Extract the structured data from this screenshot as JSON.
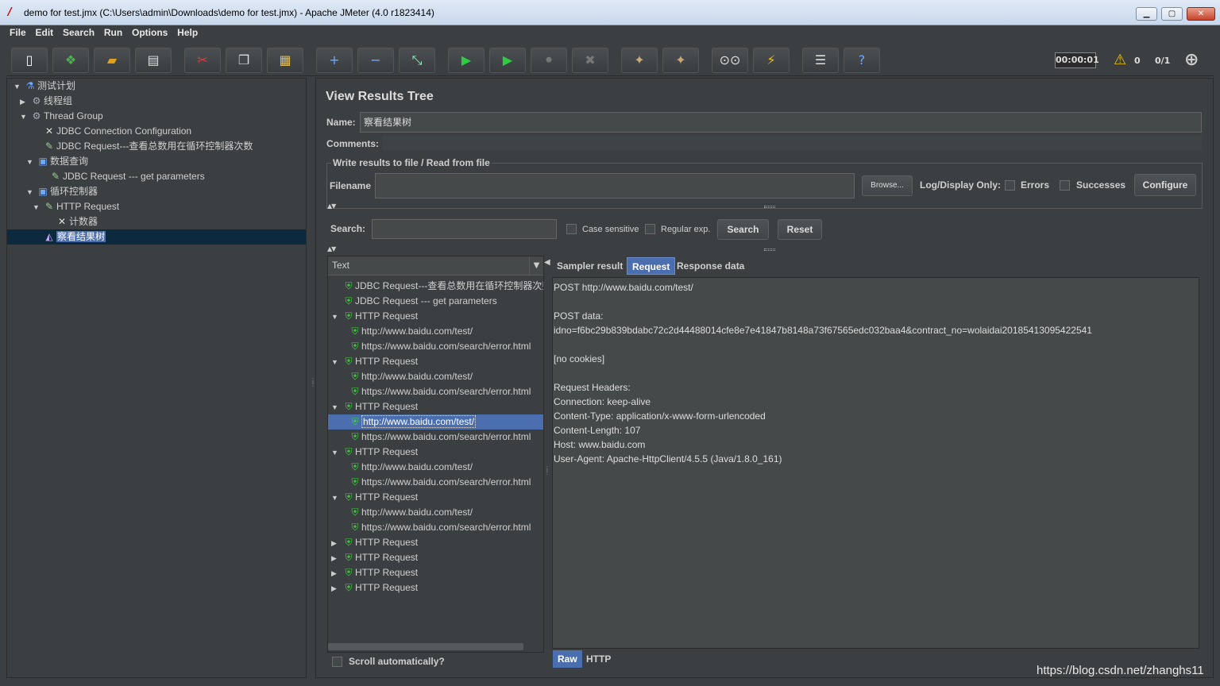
{
  "window": {
    "title": "demo for test.jmx (C:\\Users\\admin\\Downloads\\demo for test.jmx) - Apache JMeter (4.0 r1823414)"
  },
  "menu": [
    "File",
    "Edit",
    "Search",
    "Run",
    "Options",
    "Help"
  ],
  "toolbar": {
    "timer": "00:00:01",
    "warnings": "0",
    "threads": "0/1"
  },
  "tree": [
    {
      "label": "测试计划",
      "icon": "flask-icon",
      "glyph": "⚗",
      "arrow": "▼"
    },
    {
      "label": "线程组",
      "icon": "gear-icon",
      "glyph": "⚙",
      "arrow": "▶"
    },
    {
      "label": "Thread Group",
      "icon": "gear-icon",
      "glyph": "⚙",
      "arrow": "▼"
    },
    {
      "label": "JDBC Connection Configuration",
      "icon": "wrench-icon",
      "glyph": "✕",
      "arrow": ""
    },
    {
      "label": "JDBC Request---查看总数用在循环控制器次数",
      "icon": "pipette-icon",
      "glyph": "✎",
      "arrow": ""
    },
    {
      "label": "数据查询",
      "icon": "controller-icon",
      "glyph": "▣",
      "arrow": "▼"
    },
    {
      "label": "JDBC Request --- get parameters",
      "icon": "pipette-icon",
      "glyph": "✎",
      "arrow": ""
    },
    {
      "label": "循环控制器",
      "icon": "controller-icon",
      "glyph": "▣",
      "arrow": "▼"
    },
    {
      "label": "HTTP Request",
      "icon": "pipette-icon",
      "glyph": "✎",
      "arrow": "▼"
    },
    {
      "label": "计数器",
      "icon": "wrench-icon",
      "glyph": "✕",
      "arrow": ""
    },
    {
      "label": "察看结果树",
      "icon": "chart-icon",
      "glyph": "◭",
      "arrow": ""
    }
  ],
  "panel": {
    "title": "View Results Tree",
    "name_label": "Name:",
    "name_value": "察看结果树",
    "comments_label": "Comments:",
    "fieldset_legend": "Write results to file / Read from file",
    "filename_label": "Filename",
    "browse": "Browse...",
    "log_display": "Log/Display Only:",
    "errors": "Errors",
    "successes": "Successes",
    "configure": "Configure",
    "search_label": "Search:",
    "case_sensitive": "Case sensitive",
    "regular_exp": "Regular exp.",
    "search_btn": "Search",
    "reset_btn": "Reset",
    "list_header": "Text",
    "scroll_auto": "Scroll automatically?",
    "tabs": [
      "Sampler result",
      "Request",
      "Response data"
    ],
    "bottom_tabs": [
      "Raw",
      "HTTP"
    ]
  },
  "results": [
    {
      "label": "JDBC Request---查看总数用在循环控制器次数",
      "arrow": ""
    },
    {
      "label": "JDBC Request --- get parameters",
      "arrow": ""
    },
    {
      "label": "HTTP Request",
      "arrow": "▼"
    },
    {
      "label": "http://www.baidu.com/test/",
      "arrow": "",
      "child": true
    },
    {
      "label": "https://www.baidu.com/search/error.html",
      "arrow": "",
      "child": true
    },
    {
      "label": "HTTP Request",
      "arrow": "▼"
    },
    {
      "label": "http://www.baidu.com/test/",
      "arrow": "",
      "child": true
    },
    {
      "label": "https://www.baidu.com/search/error.html",
      "arrow": "",
      "child": true
    },
    {
      "label": "HTTP Request",
      "arrow": "▼"
    },
    {
      "label": "http://www.baidu.com/test/",
      "arrow": "",
      "child": true,
      "selected": true
    },
    {
      "label": "https://www.baidu.com/search/error.html",
      "arrow": "",
      "child": true
    },
    {
      "label": "HTTP Request",
      "arrow": "▼"
    },
    {
      "label": "http://www.baidu.com/test/",
      "arrow": "",
      "child": true
    },
    {
      "label": "https://www.baidu.com/search/error.html",
      "arrow": "",
      "child": true
    },
    {
      "label": "HTTP Request",
      "arrow": "▼"
    },
    {
      "label": "http://www.baidu.com/test/",
      "arrow": "",
      "child": true
    },
    {
      "label": "https://www.baidu.com/search/error.html",
      "arrow": "",
      "child": true
    },
    {
      "label": "HTTP Request",
      "arrow": "▶"
    },
    {
      "label": "HTTP Request",
      "arrow": "▶"
    },
    {
      "label": "HTTP Request",
      "arrow": "▶"
    },
    {
      "label": "HTTP Request",
      "arrow": "▶"
    }
  ],
  "request_lines": [
    "POST http://www.baidu.com/test/",
    "",
    "POST data:",
    "idno=f6bc29b839bdabc72c2d44488014cfe8e7e41847b8148a73f67565edc032baa4&contract_no=wolaidai20185413095422541",
    "",
    "[no cookies]",
    "",
    "Request Headers:",
    "Connection: keep-alive",
    "Content-Type: application/x-www-form-urlencoded",
    "Content-Length: 107",
    "Host: www.baidu.com",
    "User-Agent: Apache-HttpClient/4.5.5 (Java/1.8.0_161)"
  ],
  "watermark": "https://blog.csdn.net/zhanghs11"
}
